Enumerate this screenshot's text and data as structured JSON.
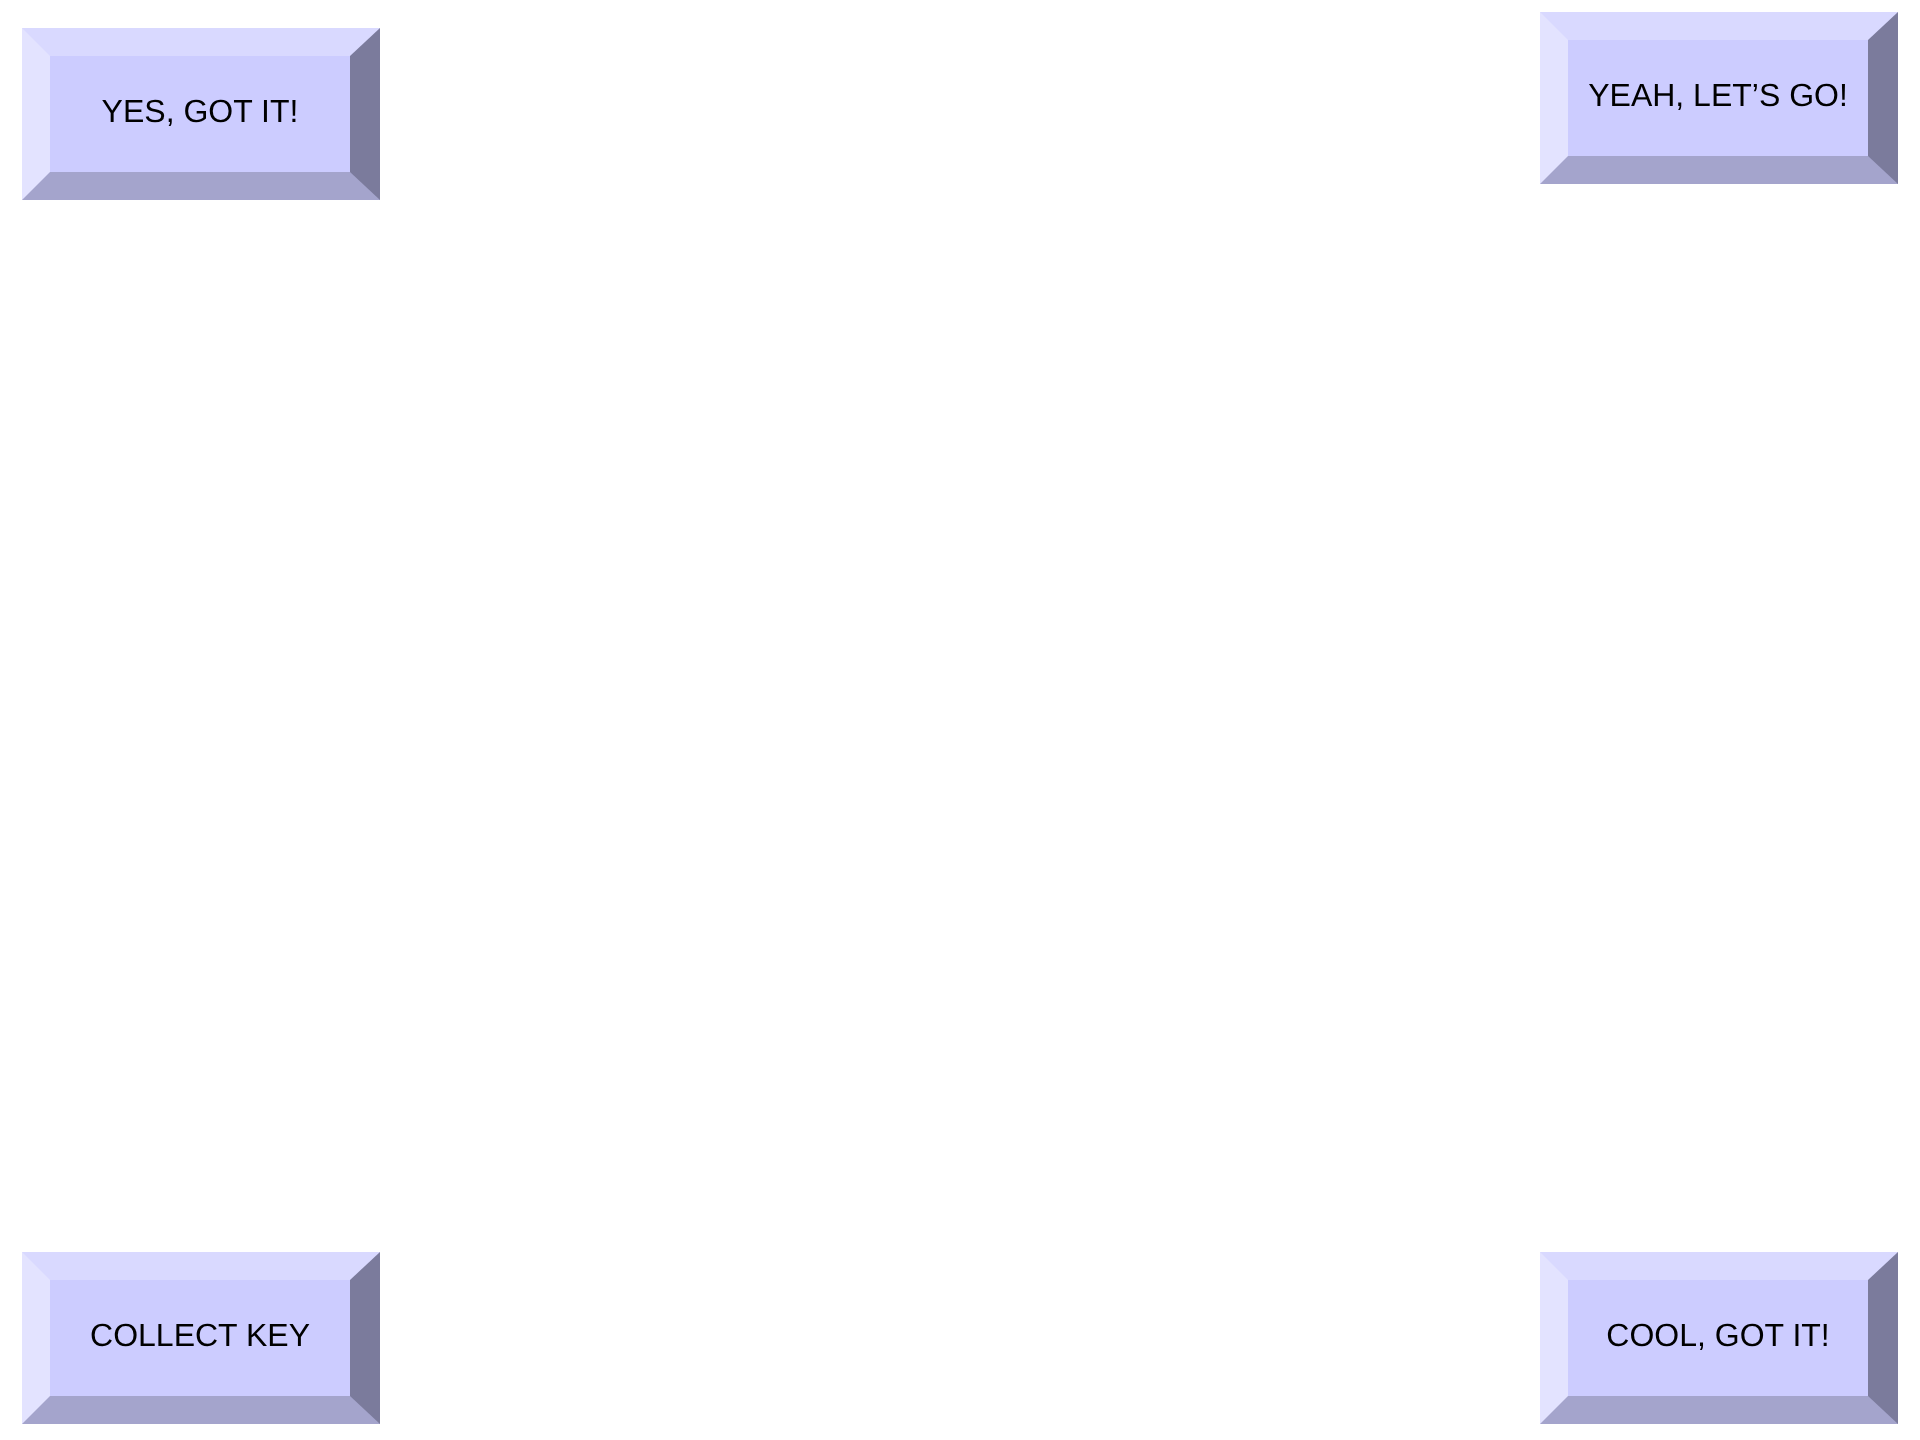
{
  "buttons": [
    {
      "label": "YES, GOT IT!"
    },
    {
      "label": "YEAH, LET’S GO!"
    },
    {
      "label": "COLLECT KEY"
    },
    {
      "label": "COOL, GOT IT!"
    }
  ]
}
